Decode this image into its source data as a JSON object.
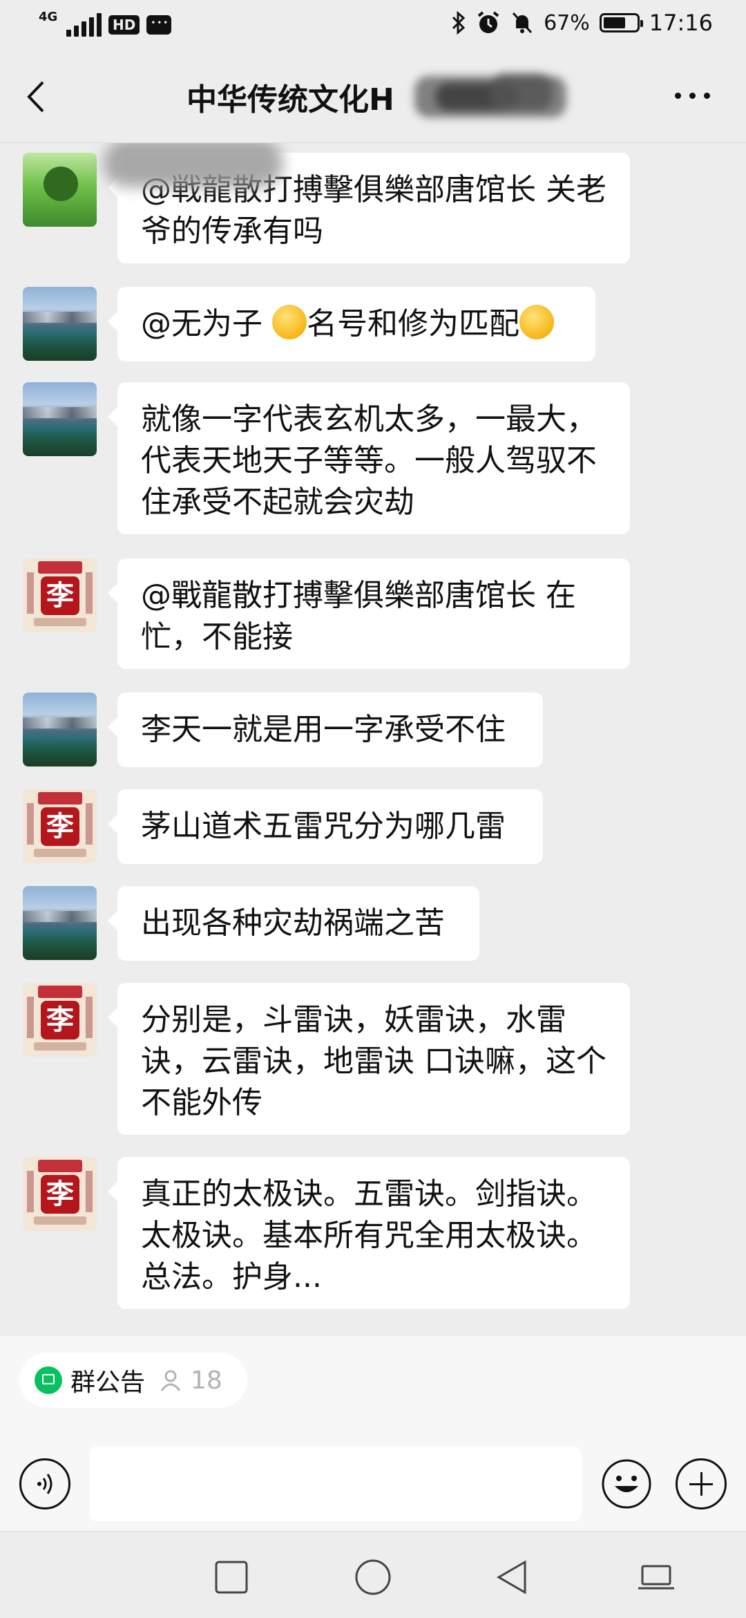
{
  "status_bar": {
    "network": "4G",
    "hd": "HD",
    "battery_percent": "67%",
    "battery_level": 0.67,
    "time": "17:16"
  },
  "header": {
    "title": "中华传统文化H"
  },
  "messages": [
    {
      "sender_avatar": "tree-avatar",
      "text": "@戦龍散打搏擊俱樂部唐馆长  关老爷的传承有吗"
    },
    {
      "sender_avatar": "lake-landscape-avatar",
      "text_before": "@无为子 ",
      "text_mid": "名号和修为匹配",
      "emoji1": "thinking-face",
      "emoji2": "laughing-crying-face"
    },
    {
      "sender_avatar": "lake-landscape-avatar",
      "text": "就像一字代表玄机太多，一最大，代表天地天子等等。一般人驾驭不住承受不起就会灾劫"
    },
    {
      "sender_avatar": "li-seal-avatar",
      "text": "@戰龍散打搏擊俱樂部唐馆长  在忙，不能接"
    },
    {
      "sender_avatar": "lake-landscape-avatar",
      "text": "李天一就是用一字承受不住"
    },
    {
      "sender_avatar": "li-seal-avatar",
      "text": "茅山道术五雷咒分为哪几雷"
    },
    {
      "sender_avatar": "lake-landscape-avatar",
      "text": "出现各种灾劫祸端之苦"
    },
    {
      "sender_avatar": "li-seal-avatar",
      "text": "分别是，斗雷诀，妖雷诀，水雷诀，云雷诀，地雷诀 口诀嘛，这个不能外传"
    },
    {
      "sender_avatar": "li-seal-avatar",
      "text": "真正的太极诀。五雷诀。剑指诀。太极诀。基本所有咒全用太极诀。总法。护身..."
    }
  ],
  "avatar_seal_char": "李",
  "notice": {
    "label": "群公告",
    "member_count": "18"
  },
  "input": {
    "placeholder": ""
  },
  "colors": {
    "background": "#ededed",
    "bubble": "#ffffff",
    "notice_icon": "#07c160"
  }
}
